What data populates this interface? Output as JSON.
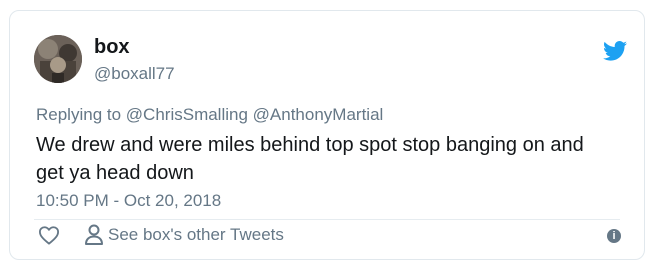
{
  "tweet": {
    "author_name": "box",
    "author_handle": "@boxall77",
    "replying_prefix": "Replying to",
    "reply_mentions": [
      "@ChrisSmalling",
      "@AnthonyMartial"
    ],
    "text": "We drew and were miles behind top spot stop banging on and get ya head down",
    "timestamp": "10:50 PM - Oct 20, 2018"
  },
  "actions": {
    "other_tweets_label": "See box's other Tweets"
  },
  "icons": {
    "brand": "twitter-bird-icon",
    "like": "heart-icon",
    "profile": "person-icon",
    "info": "info-icon"
  },
  "colors": {
    "brand_blue": "#1da1f2",
    "secondary_text": "#657786",
    "primary_text": "#14171a"
  }
}
